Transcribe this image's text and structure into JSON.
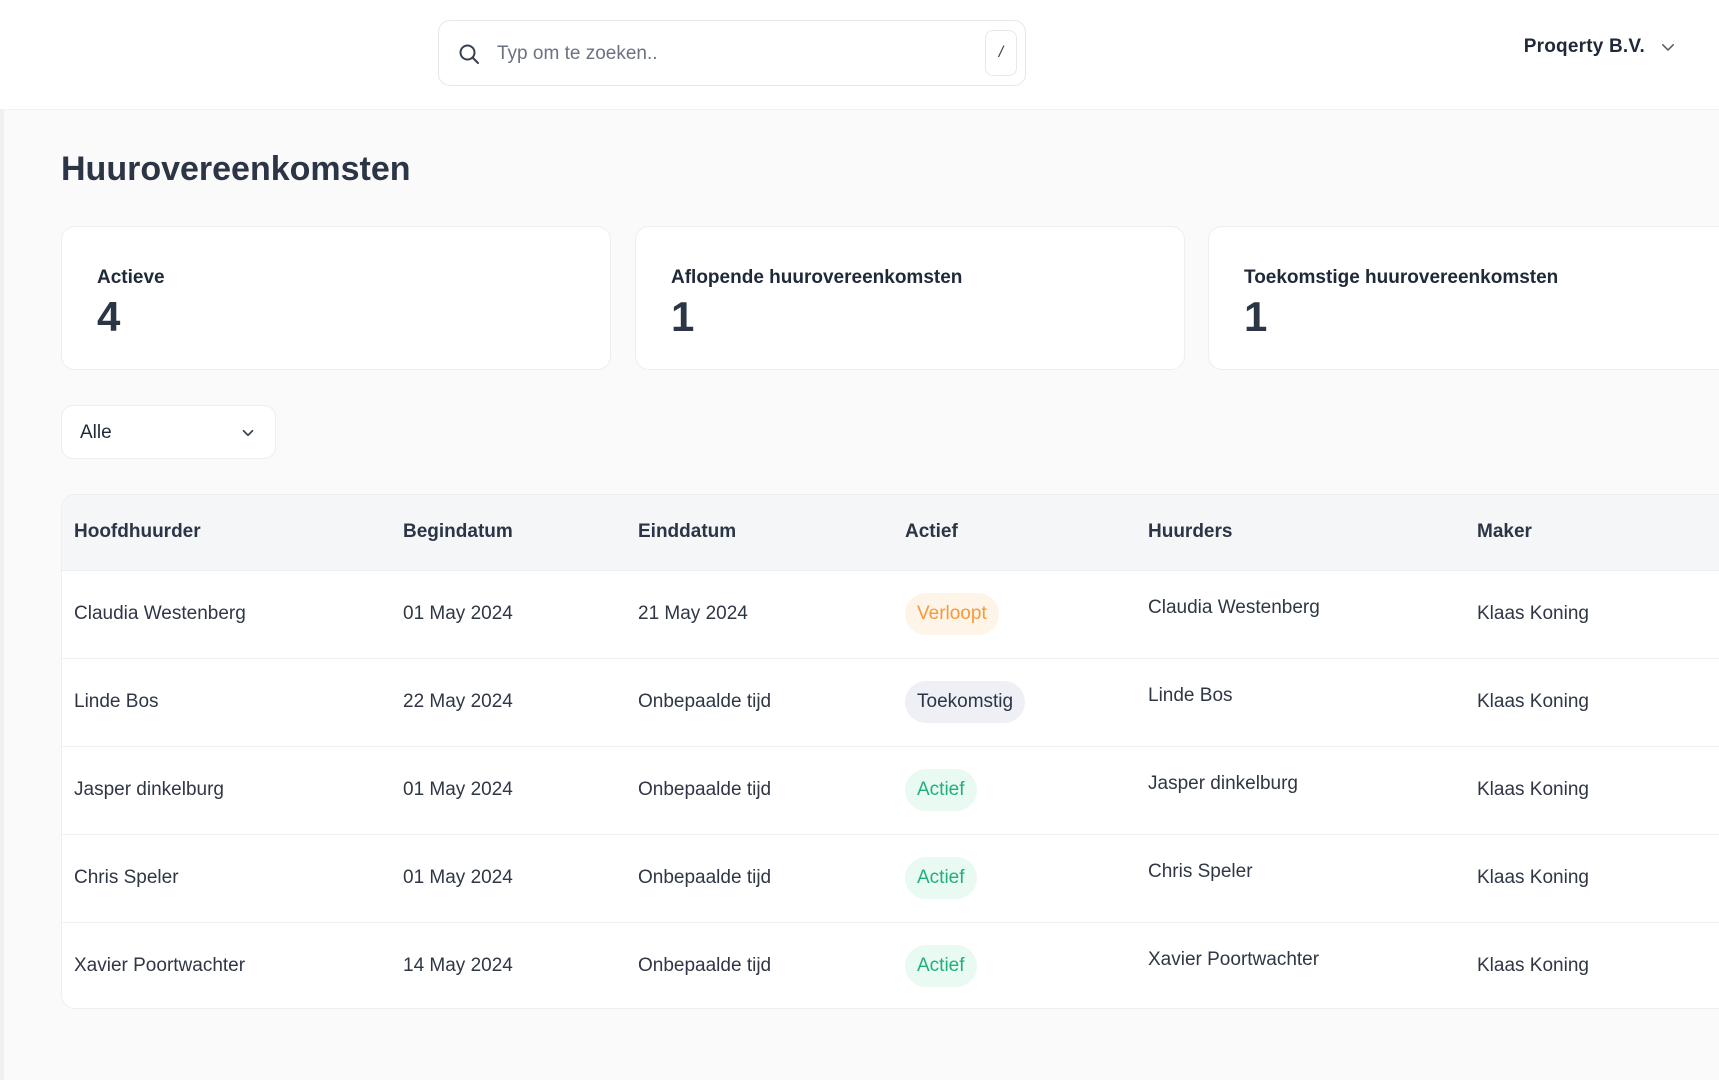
{
  "search": {
    "placeholder": "Typ om te zoeken..",
    "shortcut": "/"
  },
  "org": {
    "name": "Proqerty B.V."
  },
  "page": {
    "title": "Huurovereenkomsten"
  },
  "stats": [
    {
      "label": "Actieve",
      "value": "4"
    },
    {
      "label": "Aflopende huurovereenkomsten",
      "value": "1"
    },
    {
      "label": "Toekomstige huurovereenkomsten",
      "value": "1"
    }
  ],
  "filter": {
    "value": "Alle"
  },
  "table": {
    "headers": [
      "Hoofdhuurder",
      "Begindatum",
      "Einddatum",
      "Actief",
      "Huurders",
      "Maker"
    ],
    "rows": [
      {
        "hoofdhuurder": "Claudia Westenberg",
        "begindatum": "01 May 2024",
        "einddatum": "21 May 2024",
        "status": "Verloopt",
        "huurders": "Claudia Westenberg",
        "maker": "Klaas Koning"
      },
      {
        "hoofdhuurder": "Linde Bos",
        "begindatum": "22 May 2024",
        "einddatum": "Onbepaalde tijd",
        "status": "Toekomstig",
        "huurders": "Linde Bos",
        "maker": "Klaas Koning"
      },
      {
        "hoofdhuurder": "Jasper dinkelburg",
        "begindatum": "01 May 2024",
        "einddatum": "Onbepaalde tijd",
        "status": "Actief",
        "huurders": "Jasper dinkelburg",
        "maker": "Klaas Koning"
      },
      {
        "hoofdhuurder": "Chris Speler",
        "begindatum": "01 May 2024",
        "einddatum": "Onbepaalde tijd",
        "status": "Actief",
        "huurders": "Chris Speler",
        "maker": "Klaas Koning"
      },
      {
        "hoofdhuurder": "Xavier Poortwachter",
        "begindatum": "14 May 2024",
        "einddatum": "Onbepaalde tijd",
        "status": "Actief",
        "huurders": "Xavier Poortwachter",
        "maker": "Klaas Koning"
      }
    ]
  },
  "status_colors": {
    "Verloopt": {
      "text": "#f59a3c",
      "bg": "#fff4e8"
    },
    "Toekomstig": {
      "text": "#2b3545",
      "bg": "#eef0f6"
    },
    "Actief": {
      "text": "#22b07d",
      "bg": "#e8faf2"
    }
  },
  "icons": {
    "search": "search-icon",
    "org_chevron": "chevron-down-icon",
    "filter_chevron": "chevron-down-icon"
  }
}
